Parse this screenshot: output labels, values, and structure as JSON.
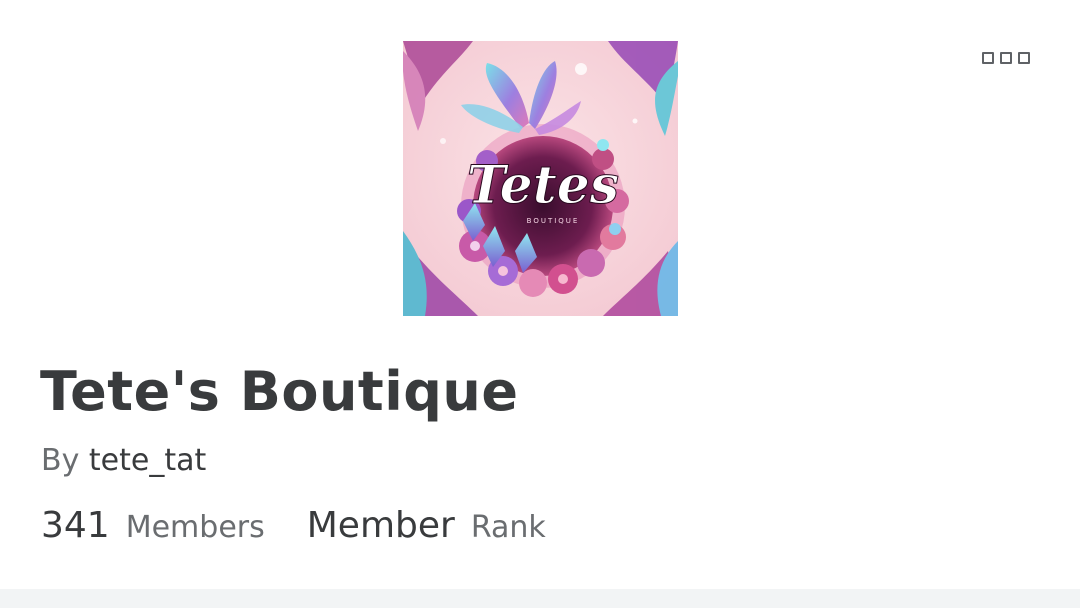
{
  "group": {
    "name": "Tete's Boutique",
    "logo_text": "Tetes",
    "logo_subtext": "BOUTIQUE",
    "owner_prefix": "By",
    "owner_name": "tete_tat"
  },
  "stats": {
    "members_value": "341",
    "members_label": "Members",
    "rank_value": "Member",
    "rank_label": "Rank"
  },
  "icons": {
    "menu": "more-options-icon"
  },
  "colors": {
    "text_primary": "#393b3d",
    "text_secondary": "#6a6d70",
    "logo_background": "#f8d5dc",
    "footer_band": "#f2f4f5"
  }
}
